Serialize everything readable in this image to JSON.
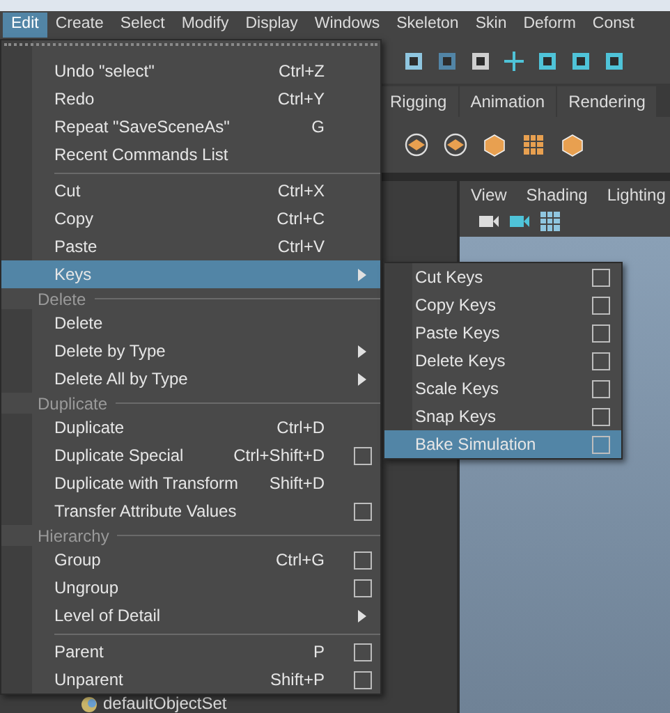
{
  "menubar": [
    {
      "label": "Edit",
      "selected": true
    },
    {
      "label": "Create",
      "selected": false
    },
    {
      "label": "Select",
      "selected": false
    },
    {
      "label": "Modify",
      "selected": false
    },
    {
      "label": "Display",
      "selected": false
    },
    {
      "label": "Windows",
      "selected": false
    },
    {
      "label": "Skeleton",
      "selected": false
    },
    {
      "label": "Skin",
      "selected": false
    },
    {
      "label": "Deform",
      "selected": false
    },
    {
      "label": "Const",
      "selected": false
    }
  ],
  "shelf_tabs": [
    {
      "label": "Rigging",
      "selected": false
    },
    {
      "label": "Animation",
      "selected": false
    },
    {
      "label": "Rendering",
      "selected": false
    }
  ],
  "viewport_menu": [
    "View",
    "Shading",
    "Lighting"
  ],
  "outliner": {
    "items": [
      "defaultObjectSet"
    ]
  },
  "edit_menu": {
    "items": [
      {
        "kind": "item",
        "label": "Undo \"select\"",
        "shortcut": "Ctrl+Z",
        "option_box": false,
        "submenu": false,
        "selected": false
      },
      {
        "kind": "item",
        "label": "Redo",
        "shortcut": "Ctrl+Y",
        "option_box": false,
        "submenu": false,
        "selected": false
      },
      {
        "kind": "item",
        "label": "Repeat \"SaveSceneAs\"",
        "shortcut": "G",
        "option_box": false,
        "submenu": false,
        "selected": false
      },
      {
        "kind": "item",
        "label": "Recent Commands List",
        "option_box": false,
        "submenu": false,
        "selected": false
      },
      {
        "kind": "separator"
      },
      {
        "kind": "item",
        "label": "Cut",
        "shortcut": "Ctrl+X",
        "option_box": false,
        "submenu": false,
        "selected": false
      },
      {
        "kind": "item",
        "label": "Copy",
        "shortcut": "Ctrl+C",
        "option_box": false,
        "submenu": false,
        "selected": false
      },
      {
        "kind": "item",
        "label": "Paste",
        "shortcut": "Ctrl+V",
        "option_box": false,
        "submenu": false,
        "selected": false
      },
      {
        "kind": "item",
        "label": "Keys",
        "option_box": false,
        "submenu": true,
        "selected": true
      },
      {
        "kind": "header",
        "label": "Delete"
      },
      {
        "kind": "item",
        "label": "Delete",
        "option_box": false,
        "submenu": false,
        "selected": false
      },
      {
        "kind": "item",
        "label": "Delete by Type",
        "option_box": false,
        "submenu": true,
        "selected": false
      },
      {
        "kind": "item",
        "label": "Delete All by Type",
        "option_box": false,
        "submenu": true,
        "selected": false
      },
      {
        "kind": "header",
        "label": "Duplicate"
      },
      {
        "kind": "item",
        "label": "Duplicate",
        "shortcut": "Ctrl+D",
        "option_box": false,
        "submenu": false,
        "selected": false
      },
      {
        "kind": "item",
        "label": "Duplicate Special",
        "shortcut": "Ctrl+Shift+D",
        "option_box": true,
        "submenu": false,
        "selected": false
      },
      {
        "kind": "item",
        "label": "Duplicate with Transform",
        "shortcut": "Shift+D",
        "option_box": false,
        "submenu": false,
        "selected": false
      },
      {
        "kind": "item",
        "label": "Transfer Attribute Values",
        "option_box": true,
        "submenu": false,
        "selected": false
      },
      {
        "kind": "header",
        "label": "Hierarchy"
      },
      {
        "kind": "item",
        "label": "Group",
        "shortcut": "Ctrl+G",
        "option_box": true,
        "submenu": false,
        "selected": false
      },
      {
        "kind": "item",
        "label": "Ungroup",
        "option_box": true,
        "submenu": false,
        "selected": false
      },
      {
        "kind": "item",
        "label": "Level of Detail",
        "option_box": false,
        "submenu": true,
        "selected": false
      },
      {
        "kind": "separator"
      },
      {
        "kind": "item",
        "label": "Parent",
        "shortcut": "P",
        "option_box": true,
        "submenu": false,
        "selected": false
      },
      {
        "kind": "item",
        "label": "Unparent",
        "shortcut": "Shift+P",
        "option_box": true,
        "submenu": false,
        "selected": false
      }
    ]
  },
  "keys_submenu": {
    "items": [
      {
        "label": "Cut Keys",
        "option_box": true,
        "selected": false
      },
      {
        "label": "Copy Keys",
        "option_box": true,
        "selected": false
      },
      {
        "label": "Paste Keys",
        "option_box": true,
        "selected": false
      },
      {
        "label": "Delete Keys",
        "option_box": true,
        "selected": false
      },
      {
        "label": "Scale Keys",
        "option_box": true,
        "selected": false
      },
      {
        "label": "Snap Keys",
        "option_box": true,
        "selected": false
      },
      {
        "label": "Bake Simulation",
        "option_box": true,
        "selected": true
      }
    ]
  }
}
